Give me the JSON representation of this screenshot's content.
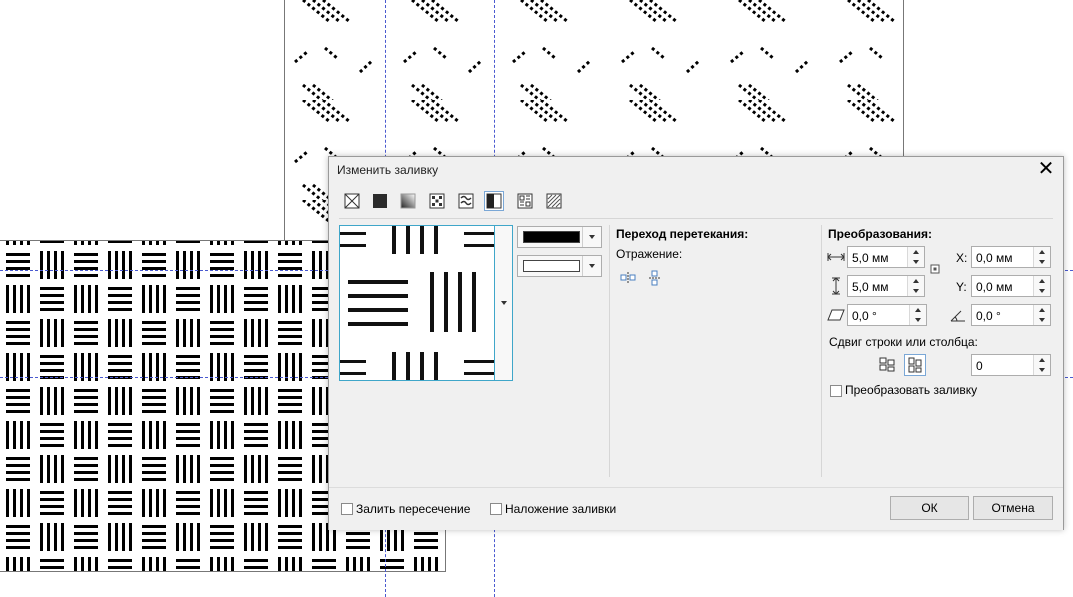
{
  "dialog": {
    "title": "Изменить заливку",
    "close_label": "✕"
  },
  "fill_types": [
    "no-fill-icon",
    "uniform-fill-icon",
    "fountain-fill-icon",
    "vector-pattern-icon",
    "bitmap-pattern-icon",
    "two-color-pattern-icon",
    "texture-fill-icon",
    "postscript-fill-icon"
  ],
  "blend": {
    "heading": "Переход перетекания:",
    "mirror_label": "Отражение:"
  },
  "transform": {
    "heading": "Преобразования:",
    "width": "5,0 мм",
    "height": "5,0 мм",
    "skew": "0,0 °",
    "x_label": "X:",
    "x": "0,0 мм",
    "y_label": "Y:",
    "y": "0,0 мм",
    "rotate": "0,0 °",
    "offset_label": "Сдвиг строки или столбца:",
    "offset_value": "0",
    "transform_fill_label": "Преобразовать заливку"
  },
  "footer": {
    "fill_intersection": "Залить пересечение",
    "overprint": "Наложение заливки",
    "ok": "ОК",
    "cancel": "Отмена"
  },
  "colors": {
    "foreground": "#000000",
    "background": "#ffffff"
  }
}
